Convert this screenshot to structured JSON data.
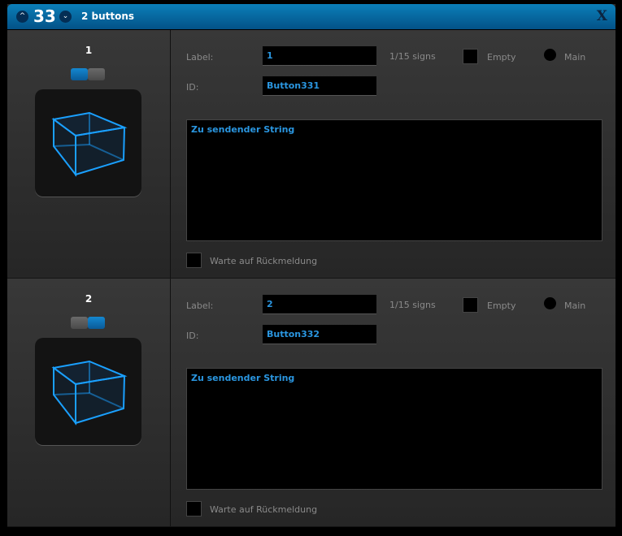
{
  "header": {
    "number": "33",
    "title": "2 buttons",
    "up_icon": "chevron-up-icon",
    "down_icon": "chevron-down-icon",
    "close_label": "X"
  },
  "labels": {
    "label": "Label:",
    "id": "ID:",
    "empty": "Empty",
    "main": "Main",
    "wait": "Warte auf Rückmeldung"
  },
  "buttons": [
    {
      "index": "1",
      "label": "1",
      "id": "Button331",
      "signs": "1/15 signs",
      "string": "Zu sendender String",
      "toggle_active": "left"
    },
    {
      "index": "2",
      "label": "2",
      "id": "Button332",
      "signs": "1/15 signs",
      "string": "Zu sendender String",
      "toggle_active": "right"
    }
  ],
  "colors": {
    "accent": "#2a96e0",
    "title_bar": "#0b6aa3"
  }
}
